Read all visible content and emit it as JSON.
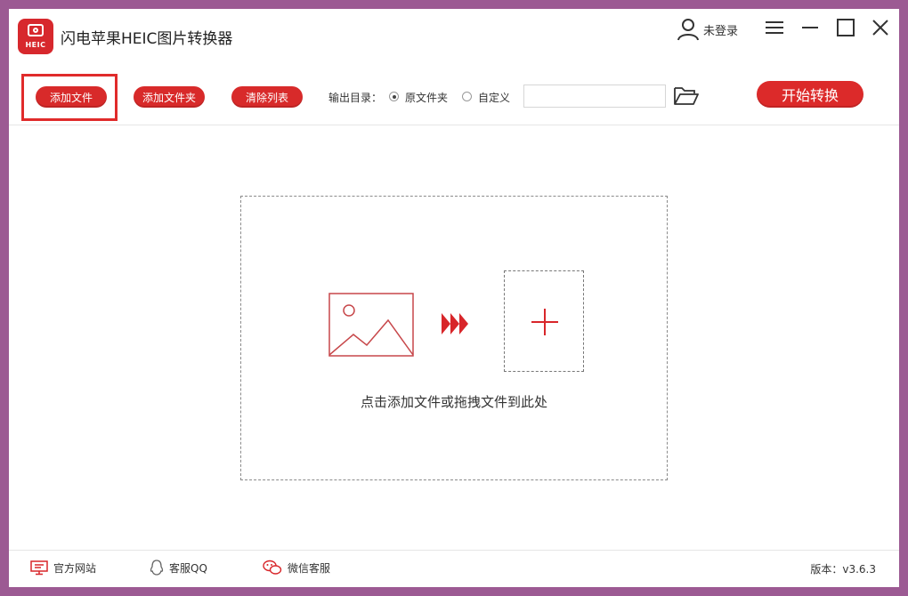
{
  "app": {
    "title": "闪电苹果HEIC图片转换器",
    "logo_text": "HEIC",
    "user_label": "未登录"
  },
  "toolbar": {
    "add_file": "添加文件",
    "add_folder": "添加文件夹",
    "clear_list": "清除列表",
    "output_label": "输出目录：",
    "radio_original": "原文件夹",
    "radio_custom": "自定义",
    "output_path": "",
    "start": "开始转换"
  },
  "drop_zone": {
    "hint": "点击添加文件或拖拽文件到此处"
  },
  "footer": {
    "website": "官方网站",
    "qq": "客服QQ",
    "wechat": "微信客服",
    "version": "版本：v3.6.3"
  },
  "colors": {
    "accent": "#d82a2a",
    "frame": "#9c5a93"
  },
  "icons": [
    "user-icon",
    "menu-icon",
    "minimize-icon",
    "maximize-icon",
    "close-icon",
    "folder-open-icon",
    "image-icon",
    "forward-arrows-icon",
    "plus-icon",
    "monitor-icon",
    "qq-icon",
    "wechat-icon"
  ]
}
